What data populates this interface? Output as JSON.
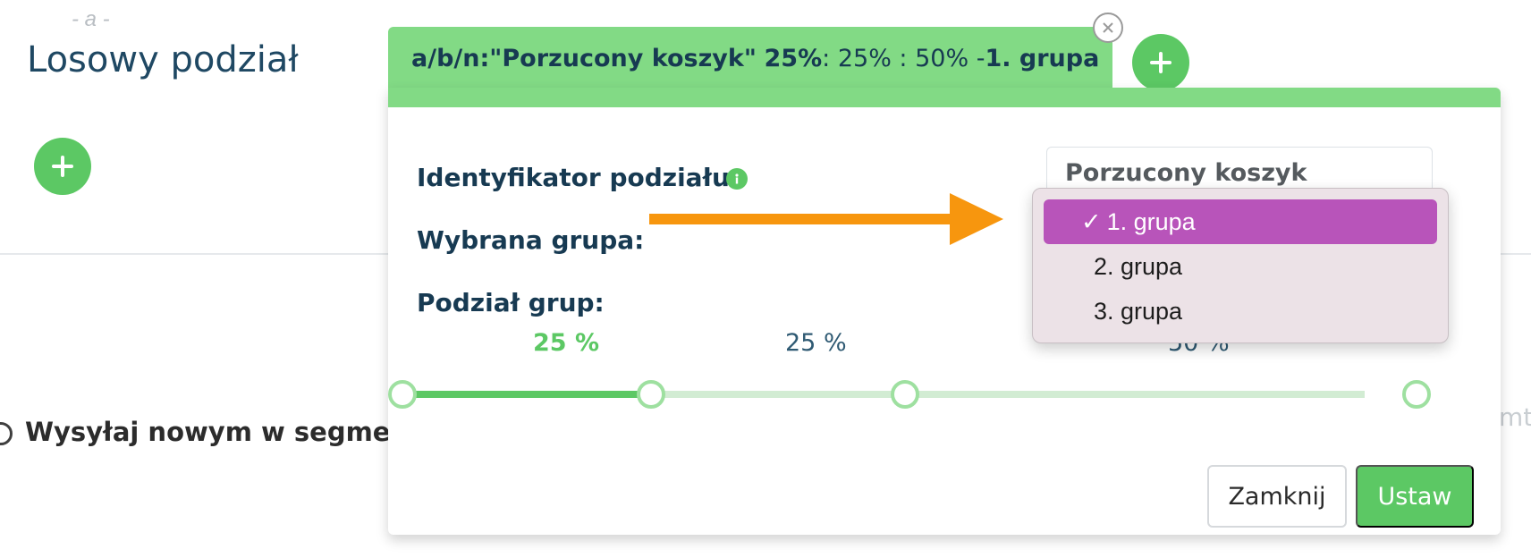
{
  "background": {
    "letter": "- a -",
    "title": "Losowy podział",
    "option": "Wysyłaj nowym w segment",
    "right_fragment": "mt"
  },
  "tab": {
    "prefix": "a/b/n: ",
    "name": "\"Porzucony koszyk\"",
    "first_pct": "25%",
    "rest": " : 25% : 50% - ",
    "group": "1. grupa"
  },
  "form": {
    "id_label": "Identyfikator podziału:",
    "id_value": "Porzucony koszyk",
    "group_label": "Wybrana grupa:",
    "split_label": "Podział grup:"
  },
  "split": {
    "labels": [
      "25 %",
      "25 %",
      "50 %"
    ],
    "values_percent": [
      25,
      25,
      50
    ],
    "active_index": 0
  },
  "dropdown": {
    "selected": "1. grupa",
    "options": [
      "1. grupa",
      "2. grupa",
      "3. grupa"
    ]
  },
  "buttons": {
    "close": "Zamknij",
    "set": "Ustaw"
  },
  "colors": {
    "green": "#5cc864",
    "tab_green": "#82da85",
    "navy": "#173a52",
    "highlight": "#b854ba",
    "arrow": "#f7960e"
  }
}
